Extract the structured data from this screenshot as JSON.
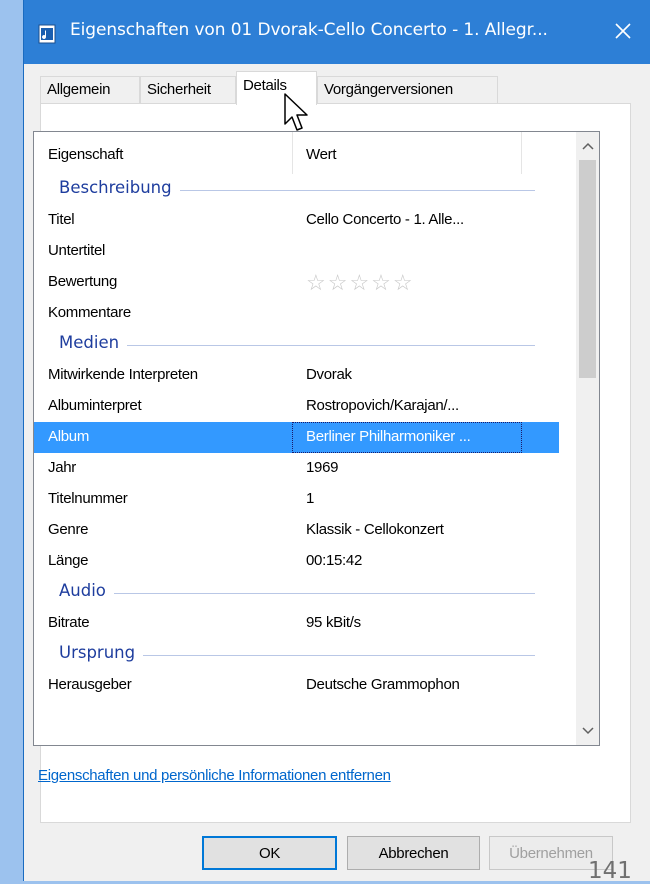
{
  "window": {
    "title": "Eigenschaften von 01 Dvorak-Cello Concerto - 1. Allegr...",
    "close_glyph": "✕"
  },
  "tabs": [
    {
      "label": "Allgemein"
    },
    {
      "label": "Sicherheit"
    },
    {
      "label": "Details",
      "active": true
    },
    {
      "label": "Vorgängerversionen"
    }
  ],
  "list": {
    "header": {
      "property": "Eigenschaft",
      "value": "Wert"
    },
    "groups": {
      "beschreibung": "Beschreibung",
      "medien": "Medien",
      "audio": "Audio",
      "ursprung": "Ursprung"
    },
    "rows": {
      "titel": {
        "k": "Titel",
        "v": "Cello Concerto - 1. Alle..."
      },
      "untertitel": {
        "k": "Untertitel",
        "v": ""
      },
      "bewertung": {
        "k": "Bewertung",
        "v": "☆☆☆☆☆",
        "rating": 0
      },
      "kommentare": {
        "k": "Kommentare",
        "v": ""
      },
      "interpreten": {
        "k": "Mitwirkende Interpreten",
        "v": "Dvorak"
      },
      "albuminterpret": {
        "k": "Albuminterpret",
        "v": "Rostropovich/Karajan/..."
      },
      "album": {
        "k": "Album",
        "v": "Berliner Philharmoniker ..."
      },
      "jahr": {
        "k": "Jahr",
        "v": "1969"
      },
      "titelnummer": {
        "k": "Titelnummer",
        "v": "1"
      },
      "genre": {
        "k": "Genre",
        "v": "Klassik - Cellokonzert"
      },
      "laenge": {
        "k": "Länge",
        "v": "00:15:42"
      },
      "bitrate": {
        "k": "Bitrate",
        "v": "95 kBit/s"
      },
      "herausgeber": {
        "k": "Herausgeber",
        "v": "Deutsche Grammophon"
      }
    }
  },
  "link": "Eigenschaften und persönliche Informationen entfernen",
  "buttons": {
    "ok": "OK",
    "cancel": "Abbrechen",
    "apply": "Übernehmen"
  },
  "page_number": "141",
  "colors": {
    "titlebar": "#2d7fd6",
    "selection": "#3399ff",
    "group_heading": "#1e3d9e",
    "link": "#0066cc"
  }
}
